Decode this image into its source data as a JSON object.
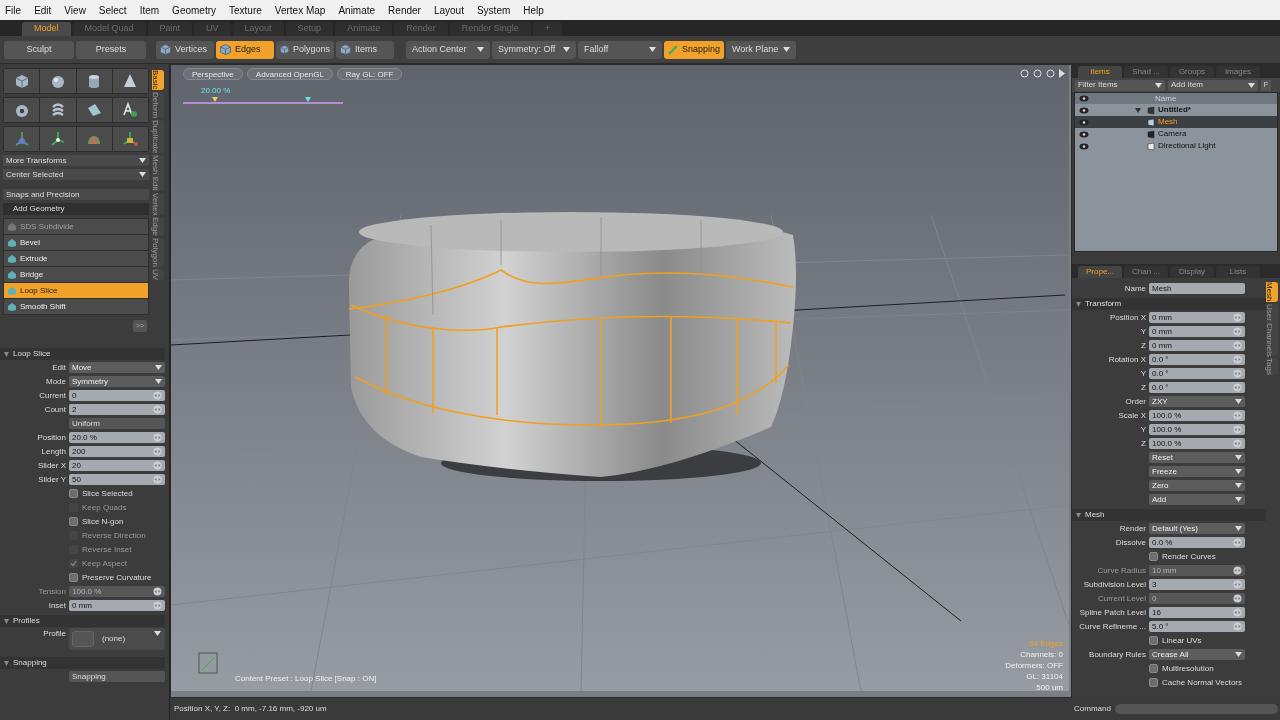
{
  "menu": [
    "File",
    "Edit",
    "View",
    "Select",
    "Item",
    "Geometry",
    "Texture",
    "Vertex Map",
    "Animate",
    "Render",
    "Layout",
    "System",
    "Help"
  ],
  "layout_tabs": [
    {
      "label": "Model",
      "selected": true
    },
    {
      "label": "Model Quad",
      "selected": false
    },
    {
      "label": "Paint",
      "selected": false
    },
    {
      "label": "UV",
      "selected": false
    },
    {
      "label": "Layout",
      "selected": false
    },
    {
      "label": "Setup",
      "selected": false
    },
    {
      "label": "Animate",
      "selected": false
    },
    {
      "label": "Render",
      "selected": false
    },
    {
      "label": "Render Single",
      "selected": false
    },
    {
      "label": "+",
      "selected": false
    }
  ],
  "toolbar": {
    "left": [
      "Sculpt",
      "Presets"
    ],
    "modes": [
      {
        "label": "Vertices",
        "selected": false
      },
      {
        "label": "Edges",
        "selected": true
      },
      {
        "label": "Polygons",
        "selected": false
      },
      {
        "label": "Items",
        "selected": false
      }
    ],
    "menus": [
      "Action Center",
      "Symmetry: Off",
      "Falloff"
    ],
    "snapping": {
      "label": "Snapping",
      "on": true
    },
    "work_plane": "Work Plane"
  },
  "tool_palette": {
    "menus": [
      "More Transforms",
      "Center Selected"
    ],
    "snaps": "Snaps and Precision",
    "section": "Add Geometry",
    "tools": [
      {
        "label": "SDS Subdivide",
        "disabled": true,
        "selected": false
      },
      {
        "label": "Bevel",
        "disabled": false,
        "selected": false
      },
      {
        "label": "Extrude",
        "disabled": false,
        "selected": false
      },
      {
        "label": "Bridge",
        "disabled": false,
        "selected": false
      },
      {
        "label": "Loop Slice",
        "disabled": false,
        "selected": true
      },
      {
        "label": "Smooth Shift",
        "disabled": false,
        "selected": false
      }
    ],
    "more": ">>"
  },
  "side_tabs": [
    {
      "label": "Basic",
      "selected": true
    },
    {
      "label": "Deform",
      "selected": false
    },
    {
      "label": "Duplicate",
      "selected": false
    },
    {
      "label": "Mesh Edit",
      "selected": false
    },
    {
      "label": "Vertex",
      "selected": false
    },
    {
      "label": "Edge",
      "selected": false
    },
    {
      "label": "Polygon",
      "selected": false
    },
    {
      "label": "UV",
      "selected": false
    }
  ],
  "tool_properties": {
    "rows": [
      {
        "kind": "section",
        "label": "Loop Slice"
      },
      {
        "kind": "dropdown",
        "label": "Edit",
        "value": "Move"
      },
      {
        "kind": "dropdown",
        "label": "Mode",
        "value": "Symmetry"
      },
      {
        "kind": "field",
        "label": "Current",
        "value": "0",
        "disabled": false
      },
      {
        "kind": "field",
        "label": "Count",
        "value": "2",
        "disabled": false
      },
      {
        "kind": "button",
        "value": "Uniform"
      },
      {
        "kind": "field",
        "label": "Position",
        "value": "20.0 %",
        "disabled": false
      },
      {
        "kind": "field",
        "label": "Length",
        "value": "200",
        "disabled": false
      },
      {
        "kind": "field",
        "label": "Slider X",
        "value": "20",
        "disabled": false
      },
      {
        "kind": "field",
        "label": "Slider Y",
        "value": "50",
        "disabled": false
      },
      {
        "kind": "checkbox",
        "label": "Slice Selected",
        "checked": false,
        "disabled": false
      },
      {
        "kind": "checkbox",
        "label": "Keep Quads",
        "checked": false,
        "disabled": true
      },
      {
        "kind": "checkbox",
        "label": "Slice N-gon",
        "checked": false,
        "disabled": false
      },
      {
        "kind": "checkbox",
        "label": "Reverse Direction",
        "checked": false,
        "disabled": true
      },
      {
        "kind": "checkbox",
        "label": "Reverse Inset",
        "checked": false,
        "disabled": true
      },
      {
        "kind": "checkbox",
        "label": "Keep Aspect",
        "checked": true,
        "disabled": true
      },
      {
        "kind": "checkbox",
        "label": "Preserve Curvature",
        "checked": false,
        "disabled": false
      },
      {
        "kind": "field",
        "label": "Tension",
        "value": "100.0 %",
        "disabled": true
      },
      {
        "kind": "field",
        "label": "Inset",
        "value": "0 mm",
        "disabled": false
      },
      {
        "kind": "section",
        "label": "Profiles"
      },
      {
        "kind": "profile",
        "label": "Profile",
        "value": "(none)"
      },
      {
        "kind": "section",
        "label": "Snapping"
      },
      {
        "kind": "button",
        "value": "Snapping"
      }
    ]
  },
  "viewport": {
    "buttons": [
      "Perspective",
      "Advanced OpenGL",
      "Ray GL: OFF"
    ],
    "slider": {
      "label": "20.00 %",
      "markers": [
        {
          "level": 0.2
        },
        {
          "level": 0.78
        }
      ]
    },
    "stats": [
      "54 Edges",
      "Channels: 0",
      "Deformers: OFF",
      "GL: 31104",
      "500 um"
    ],
    "preset": "Content Preset : Loop Slice [Snap : ON]"
  },
  "status_bar": {
    "position": "Position X, Y, Z:  0 mm, -7.16 mm, -920 um",
    "command_label": "Command"
  },
  "items_panel": {
    "tabs": [
      {
        "label": "Items",
        "selected": true
      },
      {
        "label": "Shad ...",
        "selected": false
      },
      {
        "label": "Groups",
        "selected": false
      },
      {
        "label": "Images",
        "selected": false
      }
    ],
    "filter": "Filter Items",
    "add": "Add Item",
    "f_button": "F",
    "column": "Name",
    "tree": [
      {
        "label": "Untitled*",
        "kind": "scene",
        "expanded": true,
        "selected": false,
        "children": [
          {
            "label": "Mesh",
            "kind": "mesh",
            "selected": true
          },
          {
            "label": "Camera",
            "kind": "camera",
            "selected": false
          },
          {
            "label": "Directional Light",
            "kind": "light",
            "selected": false
          }
        ]
      }
    ]
  },
  "properties_panel": {
    "tabs": [
      {
        "label": "Prope...",
        "selected": true
      },
      {
        "label": "Chan ...",
        "selected": false
      },
      {
        "label": "Display",
        "selected": false
      },
      {
        "label": "Lists",
        "selected": false
      }
    ],
    "side_tabs": [
      {
        "label": "Mesh",
        "selected": true
      },
      {
        "label": "User Channels",
        "selected": false
      },
      {
        "label": "Tags",
        "selected": false
      }
    ],
    "rows": [
      {
        "kind": "text",
        "label": "Name",
        "value": "Mesh"
      },
      {
        "kind": "section",
        "label": "Transform"
      },
      {
        "kind": "field",
        "label": "Position X",
        "value": "0 mm",
        "disabled": false
      },
      {
        "kind": "field",
        "label": "Y",
        "value": "0 mm",
        "disabled": false
      },
      {
        "kind": "field",
        "label": "Z",
        "value": "0 mm",
        "disabled": false
      },
      {
        "kind": "field",
        "label": "Rotation X",
        "value": "0.0 °",
        "disabled": false
      },
      {
        "kind": "field",
        "label": "Y",
        "value": "0.0 °",
        "disabled": false
      },
      {
        "kind": "field",
        "label": "Z",
        "value": "0.0 °",
        "disabled": false
      },
      {
        "kind": "dropdown",
        "label": "Order",
        "value": "ZXY"
      },
      {
        "kind": "field",
        "label": "Scale X",
        "value": "100.0 %",
        "disabled": false
      },
      {
        "kind": "field",
        "label": "Y",
        "value": "100.0 %",
        "disabled": false
      },
      {
        "kind": "field",
        "label": "Z",
        "value": "100.0 %",
        "disabled": false
      },
      {
        "kind": "dropdown",
        "value": "Reset"
      },
      {
        "kind": "dropdown",
        "value": "Freeze"
      },
      {
        "kind": "dropdown",
        "value": "Zero"
      },
      {
        "kind": "dropdown",
        "value": "Add"
      },
      {
        "kind": "section",
        "label": "Mesh"
      },
      {
        "kind": "dropdown",
        "label": "Render",
        "value": "Default (Yes)"
      },
      {
        "kind": "field",
        "label": "Dissolve",
        "value": "0.0 %",
        "disabled": false
      },
      {
        "kind": "checkbox",
        "label": "Render Curves",
        "checked": false,
        "disabled": false
      },
      {
        "kind": "field",
        "label": "Curve Radius",
        "value": "10 mm",
        "disabled": true
      },
      {
        "kind": "field",
        "label": "Subdivision Level",
        "value": "3",
        "disabled": false
      },
      {
        "kind": "field",
        "label": "Current Level",
        "value": "0",
        "disabled": true
      },
      {
        "kind": "field",
        "label": "Spline Patch Level",
        "value": "16",
        "disabled": false
      },
      {
        "kind": "field",
        "label": "Curve Refineme ...",
        "value": "5.0 °",
        "disabled": false
      },
      {
        "kind": "checkbox",
        "label": "Linear UVs",
        "checked": false,
        "disabled": false
      },
      {
        "kind": "dropdown",
        "label": "Boundary Rules",
        "value": "Crease All"
      },
      {
        "kind": "checkbox",
        "label": "Multiresolution",
        "checked": false,
        "disabled": false
      },
      {
        "kind": "checkbox",
        "label": "Cache Normal Vectors",
        "checked": false,
        "disabled": false
      }
    ]
  }
}
